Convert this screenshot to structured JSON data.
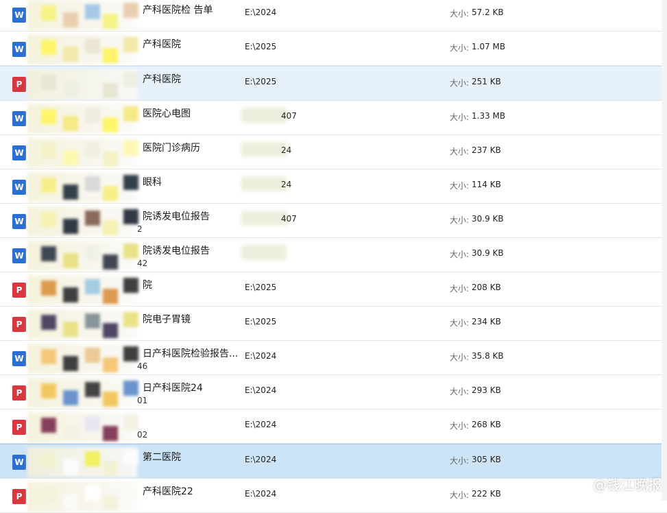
{
  "rows": [
    {
      "icon": "word",
      "name": "产科医院检 告单",
      "sub": "",
      "path": "E:\\2024",
      "size_label": "大小:",
      "size": "57.2 KB",
      "state": "normal"
    },
    {
      "icon": "word",
      "name": "产科医院",
      "sub": "",
      "path": "E:\\2025",
      "size_label": "大小:",
      "size": "1.07 MB",
      "state": "normal"
    },
    {
      "icon": "pdf",
      "name": "产科医院",
      "sub": "",
      "path": "E:\\2025",
      "size_label": "大小:",
      "size": "251 KB",
      "state": "selected-light"
    },
    {
      "icon": "word",
      "name": "医院心电图",
      "sub": "",
      "path": "407",
      "size_label": "大小:",
      "size": "1.33 MB",
      "state": "normal"
    },
    {
      "icon": "word",
      "name": "医院门诊病历",
      "sub": "",
      "path": "24",
      "size_label": "大小:",
      "size": "237 KB",
      "state": "normal"
    },
    {
      "icon": "word",
      "name": "眼科",
      "sub": "",
      "path": "24",
      "size_label": "大小:",
      "size": "114 KB",
      "state": "normal"
    },
    {
      "icon": "word",
      "name": "院诱发电位报告",
      "sub": "2",
      "path": "407",
      "size_label": "大小:",
      "size": "30.9 KB",
      "state": "normal"
    },
    {
      "icon": "word",
      "name": "院诱发电位报告",
      "sub": "42",
      "path": "",
      "size_label": "大小:",
      "size": "30.9 KB",
      "state": "normal"
    },
    {
      "icon": "pdf",
      "name": "院",
      "sub": "",
      "path": "E:\\2025",
      "size_label": "大小:",
      "size": "208 KB",
      "state": "normal"
    },
    {
      "icon": "pdf",
      "name": "院电子胃镜",
      "sub": "",
      "path": "E:\\2025",
      "size_label": "大小:",
      "size": "234 KB",
      "state": "normal"
    },
    {
      "icon": "word",
      "name": "日产科医院检验报告...",
      "sub": "46",
      "path": "E:\\2024",
      "size_label": "大小:",
      "size": "35.8 KB",
      "state": "normal"
    },
    {
      "icon": "pdf",
      "name": "日产科医院24",
      "sub": "01",
      "path": "E:\\2024",
      "size_label": "大小:",
      "size": "293 KB",
      "state": "normal"
    },
    {
      "icon": "pdf",
      "name": "",
      "sub": "02",
      "path": "E:\\2024",
      "size_label": "大小:",
      "size": "268 KB",
      "state": "normal"
    },
    {
      "icon": "word",
      "name": "第二医院",
      "sub": "",
      "path": "E:\\2024",
      "size_label": "大小:",
      "size": "305 KB",
      "state": "selected-strong"
    },
    {
      "icon": "pdf",
      "name": "产科医院22",
      "sub": "",
      "path": "E:\\2024",
      "size_label": "大小:",
      "size": "222 KB",
      "state": "normal"
    }
  ],
  "icons": {
    "word": "W",
    "pdf": "P"
  },
  "watermark": "@钱江晚报",
  "colors": {
    "selected_light": "#e6f1fb",
    "selected_strong": "#cce4f7",
    "word_icon": "#2b6fd6",
    "pdf_icon": "#d9363e"
  }
}
